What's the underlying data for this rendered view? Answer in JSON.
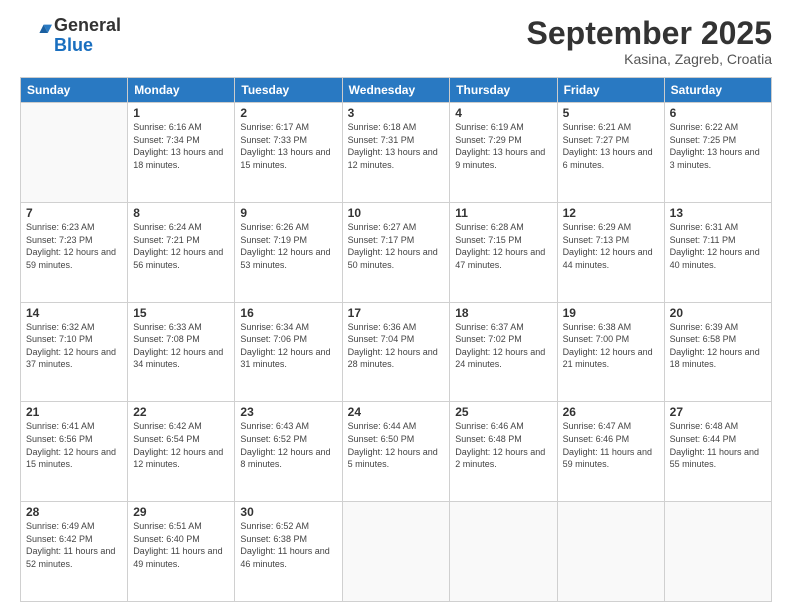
{
  "header": {
    "logo_line1": "General",
    "logo_line2": "Blue",
    "month": "September 2025",
    "location": "Kasina, Zagreb, Croatia"
  },
  "days_of_week": [
    "Sunday",
    "Monday",
    "Tuesday",
    "Wednesday",
    "Thursday",
    "Friday",
    "Saturday"
  ],
  "weeks": [
    [
      {
        "day": "",
        "sunrise": "",
        "sunset": "",
        "daylight": ""
      },
      {
        "day": "1",
        "sunrise": "Sunrise: 6:16 AM",
        "sunset": "Sunset: 7:34 PM",
        "daylight": "Daylight: 13 hours and 18 minutes."
      },
      {
        "day": "2",
        "sunrise": "Sunrise: 6:17 AM",
        "sunset": "Sunset: 7:33 PM",
        "daylight": "Daylight: 13 hours and 15 minutes."
      },
      {
        "day": "3",
        "sunrise": "Sunrise: 6:18 AM",
        "sunset": "Sunset: 7:31 PM",
        "daylight": "Daylight: 13 hours and 12 minutes."
      },
      {
        "day": "4",
        "sunrise": "Sunrise: 6:19 AM",
        "sunset": "Sunset: 7:29 PM",
        "daylight": "Daylight: 13 hours and 9 minutes."
      },
      {
        "day": "5",
        "sunrise": "Sunrise: 6:21 AM",
        "sunset": "Sunset: 7:27 PM",
        "daylight": "Daylight: 13 hours and 6 minutes."
      },
      {
        "day": "6",
        "sunrise": "Sunrise: 6:22 AM",
        "sunset": "Sunset: 7:25 PM",
        "daylight": "Daylight: 13 hours and 3 minutes."
      }
    ],
    [
      {
        "day": "7",
        "sunrise": "Sunrise: 6:23 AM",
        "sunset": "Sunset: 7:23 PM",
        "daylight": "Daylight: 12 hours and 59 minutes."
      },
      {
        "day": "8",
        "sunrise": "Sunrise: 6:24 AM",
        "sunset": "Sunset: 7:21 PM",
        "daylight": "Daylight: 12 hours and 56 minutes."
      },
      {
        "day": "9",
        "sunrise": "Sunrise: 6:26 AM",
        "sunset": "Sunset: 7:19 PM",
        "daylight": "Daylight: 12 hours and 53 minutes."
      },
      {
        "day": "10",
        "sunrise": "Sunrise: 6:27 AM",
        "sunset": "Sunset: 7:17 PM",
        "daylight": "Daylight: 12 hours and 50 minutes."
      },
      {
        "day": "11",
        "sunrise": "Sunrise: 6:28 AM",
        "sunset": "Sunset: 7:15 PM",
        "daylight": "Daylight: 12 hours and 47 minutes."
      },
      {
        "day": "12",
        "sunrise": "Sunrise: 6:29 AM",
        "sunset": "Sunset: 7:13 PM",
        "daylight": "Daylight: 12 hours and 44 minutes."
      },
      {
        "day": "13",
        "sunrise": "Sunrise: 6:31 AM",
        "sunset": "Sunset: 7:11 PM",
        "daylight": "Daylight: 12 hours and 40 minutes."
      }
    ],
    [
      {
        "day": "14",
        "sunrise": "Sunrise: 6:32 AM",
        "sunset": "Sunset: 7:10 PM",
        "daylight": "Daylight: 12 hours and 37 minutes."
      },
      {
        "day": "15",
        "sunrise": "Sunrise: 6:33 AM",
        "sunset": "Sunset: 7:08 PM",
        "daylight": "Daylight: 12 hours and 34 minutes."
      },
      {
        "day": "16",
        "sunrise": "Sunrise: 6:34 AM",
        "sunset": "Sunset: 7:06 PM",
        "daylight": "Daylight: 12 hours and 31 minutes."
      },
      {
        "day": "17",
        "sunrise": "Sunrise: 6:36 AM",
        "sunset": "Sunset: 7:04 PM",
        "daylight": "Daylight: 12 hours and 28 minutes."
      },
      {
        "day": "18",
        "sunrise": "Sunrise: 6:37 AM",
        "sunset": "Sunset: 7:02 PM",
        "daylight": "Daylight: 12 hours and 24 minutes."
      },
      {
        "day": "19",
        "sunrise": "Sunrise: 6:38 AM",
        "sunset": "Sunset: 7:00 PM",
        "daylight": "Daylight: 12 hours and 21 minutes."
      },
      {
        "day": "20",
        "sunrise": "Sunrise: 6:39 AM",
        "sunset": "Sunset: 6:58 PM",
        "daylight": "Daylight: 12 hours and 18 minutes."
      }
    ],
    [
      {
        "day": "21",
        "sunrise": "Sunrise: 6:41 AM",
        "sunset": "Sunset: 6:56 PM",
        "daylight": "Daylight: 12 hours and 15 minutes."
      },
      {
        "day": "22",
        "sunrise": "Sunrise: 6:42 AM",
        "sunset": "Sunset: 6:54 PM",
        "daylight": "Daylight: 12 hours and 12 minutes."
      },
      {
        "day": "23",
        "sunrise": "Sunrise: 6:43 AM",
        "sunset": "Sunset: 6:52 PM",
        "daylight": "Daylight: 12 hours and 8 minutes."
      },
      {
        "day": "24",
        "sunrise": "Sunrise: 6:44 AM",
        "sunset": "Sunset: 6:50 PM",
        "daylight": "Daylight: 12 hours and 5 minutes."
      },
      {
        "day": "25",
        "sunrise": "Sunrise: 6:46 AM",
        "sunset": "Sunset: 6:48 PM",
        "daylight": "Daylight: 12 hours and 2 minutes."
      },
      {
        "day": "26",
        "sunrise": "Sunrise: 6:47 AM",
        "sunset": "Sunset: 6:46 PM",
        "daylight": "Daylight: 11 hours and 59 minutes."
      },
      {
        "day": "27",
        "sunrise": "Sunrise: 6:48 AM",
        "sunset": "Sunset: 6:44 PM",
        "daylight": "Daylight: 11 hours and 55 minutes."
      }
    ],
    [
      {
        "day": "28",
        "sunrise": "Sunrise: 6:49 AM",
        "sunset": "Sunset: 6:42 PM",
        "daylight": "Daylight: 11 hours and 52 minutes."
      },
      {
        "day": "29",
        "sunrise": "Sunrise: 6:51 AM",
        "sunset": "Sunset: 6:40 PM",
        "daylight": "Daylight: 11 hours and 49 minutes."
      },
      {
        "day": "30",
        "sunrise": "Sunrise: 6:52 AM",
        "sunset": "Sunset: 6:38 PM",
        "daylight": "Daylight: 11 hours and 46 minutes."
      },
      {
        "day": "",
        "sunrise": "",
        "sunset": "",
        "daylight": ""
      },
      {
        "day": "",
        "sunrise": "",
        "sunset": "",
        "daylight": ""
      },
      {
        "day": "",
        "sunrise": "",
        "sunset": "",
        "daylight": ""
      },
      {
        "day": "",
        "sunrise": "",
        "sunset": "",
        "daylight": ""
      }
    ]
  ]
}
